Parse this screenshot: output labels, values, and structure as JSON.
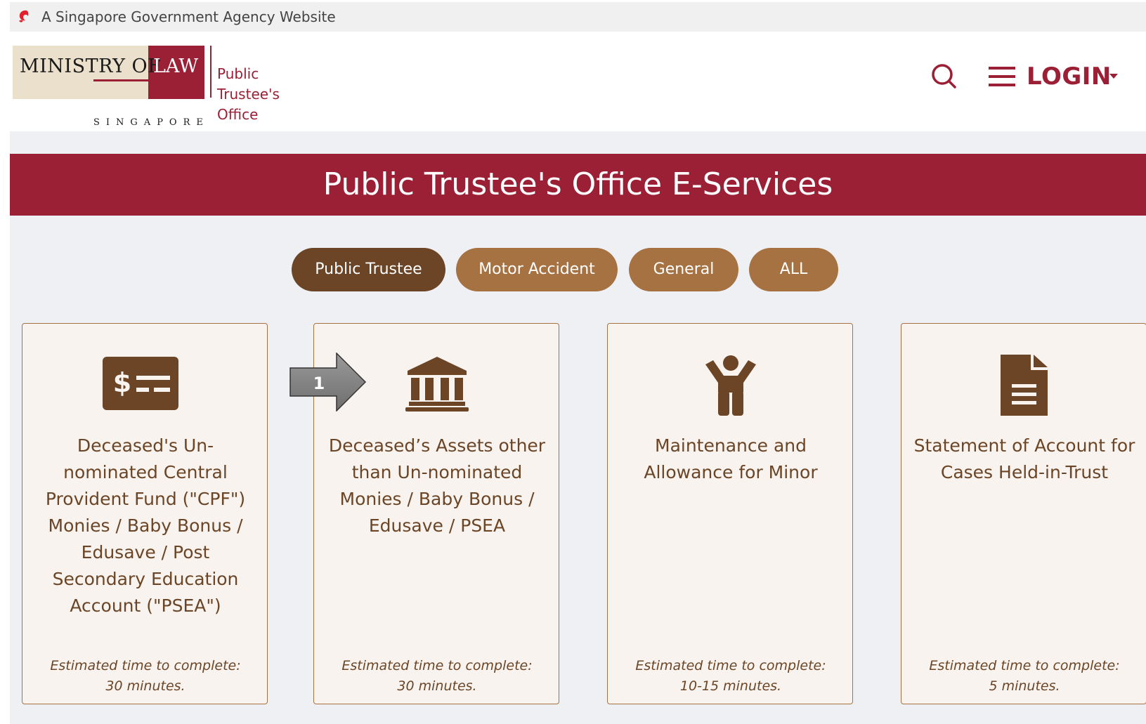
{
  "masthead": {
    "text": "A Singapore Government Agency Website"
  },
  "logo": {
    "ministry_of": "MINISTRY OF",
    "law": "LAW",
    "country": "SINGAPORE",
    "office": [
      "Public Trustee's",
      "Office"
    ]
  },
  "header": {
    "login_label": "LOGIN"
  },
  "banner": {
    "title": "Public Trustee's Office E-Services"
  },
  "tabs": [
    {
      "label": "Public Trustee",
      "active": true
    },
    {
      "label": "Motor Accident",
      "active": false
    },
    {
      "label": "General",
      "active": false
    },
    {
      "label": "ALL",
      "active": false
    }
  ],
  "cards": [
    {
      "icon": "money-bill-icon",
      "title": "Deceased's Un-nominated Central Provident Fund (\"CPF\") Monies / Baby Bonus / Edusave / Post Secondary Education Account (\"PSEA\")",
      "time_label": "Estimated time to complete:",
      "time_value": "30 minutes."
    },
    {
      "icon": "bank-building-icon",
      "title": "Deceased’s Assets other than Un-nominated Monies / Baby Bonus / Edusave / PSEA",
      "time_label": "Estimated time to complete:",
      "time_value": "30 minutes."
    },
    {
      "icon": "child-icon",
      "title": "Maintenance and Allowance for Minor",
      "time_label": "Estimated time to complete:",
      "time_value": "10-15 minutes."
    },
    {
      "icon": "document-icon",
      "title": "Statement of Account for Cases Held-in-Trust",
      "time_label": "Estimated time to complete:",
      "time_value": "5 minutes."
    }
  ],
  "annotation": {
    "step_number": "1"
  },
  "colors": {
    "brand_red": "#9b1f35",
    "tab_brown": "#a77242",
    "tab_active": "#6b4526",
    "card_bg": "#f8f3ee",
    "content_bg": "#eef0f4"
  }
}
